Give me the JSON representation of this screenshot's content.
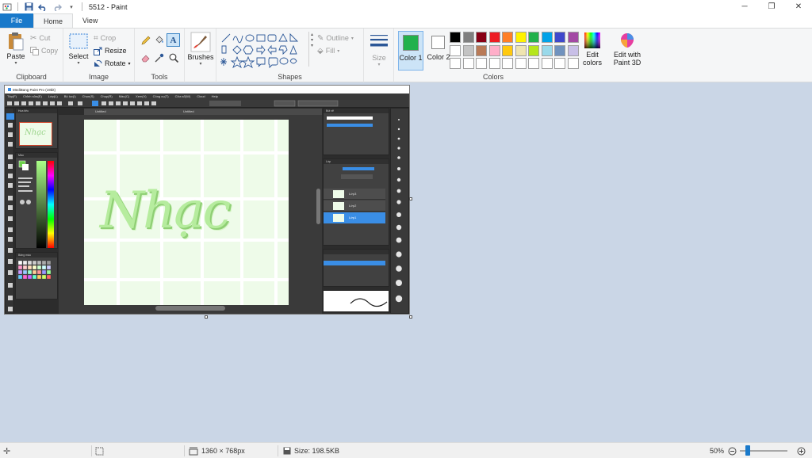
{
  "window": {
    "title": "5512 - Paint",
    "controls": [
      "─",
      "❐",
      "✕"
    ]
  },
  "tabs": [
    {
      "label": "File"
    },
    {
      "label": "Home"
    },
    {
      "label": "View"
    }
  ],
  "ribbon": {
    "clipboard": {
      "label": "Clipboard",
      "paste": "Paste",
      "cut": "Cut",
      "copy": "Copy"
    },
    "image": {
      "label": "Image",
      "select": "Select",
      "crop": "Crop",
      "resize": "Resize",
      "rotate": "Rotate"
    },
    "tools": {
      "label": "Tools"
    },
    "brushes": {
      "label": "Brushes"
    },
    "shapes": {
      "label": "Shapes",
      "outline": "Outline",
      "fill": "Fill"
    },
    "size": {
      "label": "Size"
    },
    "colors": {
      "label": "Colors",
      "color1": "Color 1",
      "color1_value": "#22b14c",
      "color2": "Color 2",
      "color2_value": "#ffffff",
      "edit_colors": "Edit colors",
      "edit_paint3d": "Edit with Paint 3D",
      "palette_row1": [
        "#000000",
        "#7f7f7f",
        "#880015",
        "#ed1c24",
        "#ff7f27",
        "#fff200",
        "#22b14c",
        "#00a2e8",
        "#3f48cc",
        "#a349a4"
      ],
      "palette_row2": [
        "#ffffff",
        "#c3c3c3",
        "#b97a57",
        "#ffaec9",
        "#ffc90e",
        "#efe4b0",
        "#b5e61d",
        "#99d9ea",
        "#7092be",
        "#c8bfe7"
      ],
      "palette_row3": [
        "#ffffff",
        "#ffffff",
        "#ffffff",
        "#ffffff",
        "#ffffff",
        "#ffffff",
        "#ffffff",
        "#ffffff",
        "#ffffff",
        "#ffffff"
      ]
    }
  },
  "inner_app": {
    "title": "MediBang Paint Pro (19bit)",
    "menu": [
      "Tệp(F)",
      "Chỉnh sửa(E)",
      "Lớp(L)",
      "Bộ lọc(I)",
      "Chọn(S)",
      "Chụp(R)",
      "Màu(C)",
      "Xem(V)",
      "Công cụ(T)",
      "Cửa sổ(W)",
      "Cloud",
      "Help"
    ],
    "doc_tab": "Untitled",
    "artwork_text": "Nhạc",
    "layers": [
      "Lớp3",
      "Lớp2",
      "Lớp1"
    ],
    "panels": {
      "navigator": "Hoa tiêu",
      "color": "Màu",
      "brush": "Bút vẽ",
      "layer": "Lớp",
      "palette": "Bảng màu"
    }
  },
  "status": {
    "dimensions": "1360 × 768px",
    "size": "Size: 198.5KB",
    "zoom": "50%",
    "zoom_fraction": 0.5
  }
}
